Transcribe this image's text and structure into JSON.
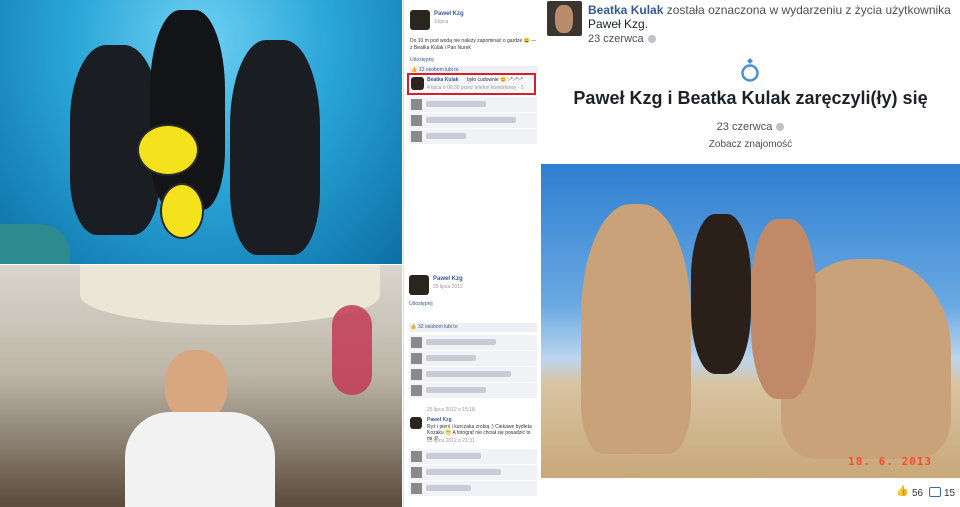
{
  "top_post": {
    "author": "Paweł Kzg",
    "date": "3 lipca",
    "caption": "Do 10 m pod wodą nie należy zapominać o gardze 😄 — z Beatka Kulak i Pan Nurek",
    "share_label": "Udostępnij",
    "likes": "12 osobom lubi to",
    "comment_author": "Beatka Kulak",
    "comment_text": "było cudownie 😊 :-*:-*:-*",
    "comment_meta": "4 lipca o 00:30 przez telefon komórkowy · 1"
  },
  "bottom_post": {
    "author": "Paweł Kzg",
    "date": "25 lipca 2012",
    "share_label": "Udostępnij",
    "likes": "32 osobom lubi to",
    "comment_date_1": "25 lipca 2012 o 15:18",
    "comment_author": "Paweł Kzg",
    "comment_text": "Ryż i pierś i kurczaka zrobią :) Ciekawe bydleta Kozaku 😁 A fotograf nie chciał się posadzić to mi :P",
    "comment_date_2": "25 lipca 2012 o 21:31"
  },
  "event_post": {
    "head_name": "Beatka Kulak",
    "head_text": " została oznaczona w wydarzeniu z życia użytkownika ",
    "head_target": "Paweł Kzg.",
    "date": "23 czerwca",
    "icon": "ring-icon",
    "event_title": "Paweł Kzg i Beatka Kulak zaręczyli(ły) się",
    "event_date": "23 czerwca",
    "see_link": "Zobacz znajomość",
    "photo_stamp": "18. 6. 2013",
    "like_count": "56",
    "comment_count": "15"
  },
  "colors": {
    "fb_blue": "#365899",
    "highlight_red": "#d42026",
    "photo_stamp": "#ff4a2f"
  }
}
